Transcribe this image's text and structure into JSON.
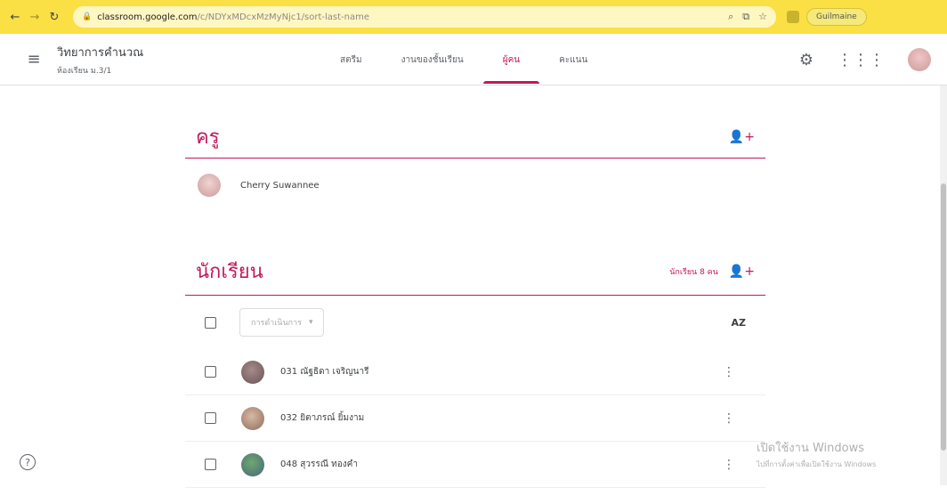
{
  "browser": {
    "url_host": "classroom.google.com",
    "url_path": "/c/NDYxMDcxMzMyNjc1/sort-last-name",
    "profile_label": "Guilmaine"
  },
  "header": {
    "class_name": "วิทยาการคำนวณ",
    "class_section": "ห้องเรียน ม.3/1",
    "tabs": [
      {
        "label": "สตรีม"
      },
      {
        "label": "งานของชั้นเรียน"
      },
      {
        "label": "ผู้คน",
        "active": true
      },
      {
        "label": "คะแนน"
      }
    ]
  },
  "teachers": {
    "title": "ครู",
    "list": [
      {
        "name": "Cherry Suwannee"
      }
    ]
  },
  "students": {
    "title": "นักเรียน",
    "count_label": "นักเรียน 8 คน",
    "actions_label": "การดำเนินการ",
    "list": [
      {
        "name": "031 ณัฐธิดา เจริญนารี"
      },
      {
        "name": "032 ยิตาภรณ์ ยิ้มงาม"
      },
      {
        "name": "048 สุวรรณี ทองคำ"
      }
    ]
  },
  "watermark": {
    "line1": "เปิดใช้งาน Windows",
    "line2": "ไปที่การตั้งค่าเพื่อเปิดใช้งาน Windows"
  },
  "colors": {
    "accent": "#c2185b",
    "browser_bar": "#fbe045"
  }
}
